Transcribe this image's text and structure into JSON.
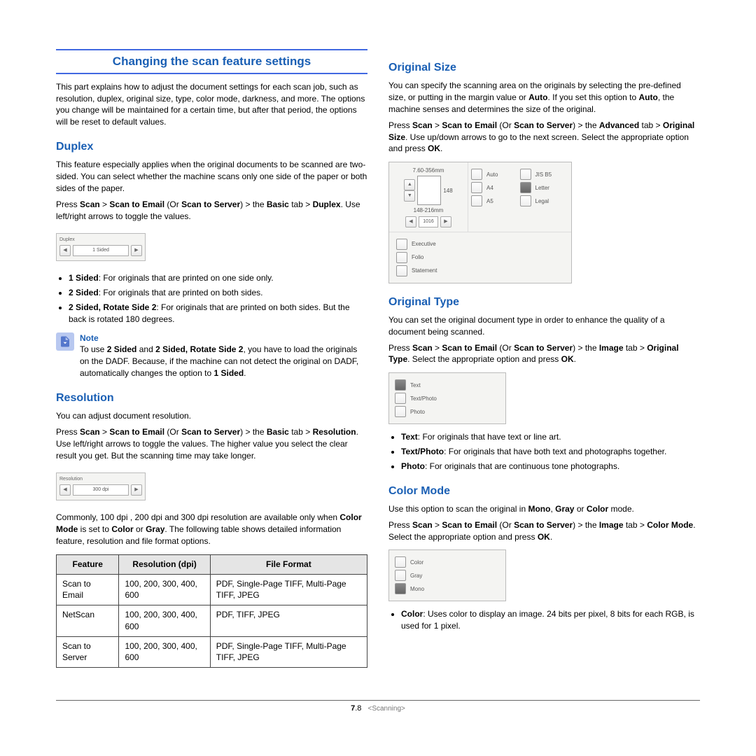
{
  "title": "Changing the scan feature settings",
  "intro": "This part explains how to adjust the document settings for each scan job, such as resolution, duplex, original size, type, color mode, darkness, and more. The options you change will be maintained for a certain time, but after that period, the options will be reset to default values.",
  "duplex": {
    "heading": "Duplex",
    "p1": "This feature especially applies when the original documents to be scanned are two-sided. You can select whether the machine scans only one side of the paper or both sides of the paper.",
    "p2_pre": "Press ",
    "scan": "Scan",
    "scan_to_email": "Scan to Email",
    "or": " (Or ",
    "scan_to_server": "Scan to Server",
    "the": ") > the ",
    "basic": "Basic",
    "tab_gt": " tab > ",
    "duplex_label": "Duplex",
    "p2_post": ". Use left/right arrows to toggle the values.",
    "b1_t": "1 Sided",
    "b1": ": For originals that are printed on one side only.",
    "b2_t": "2 Sided",
    "b2": ": For originals that are printed on both sides.",
    "b3_t": "2 Sided, Rotate Side 2",
    "b3": ": For originals that are printed on both sides. But the back is rotated 180 degrees.",
    "note_title": "Note",
    "note_body_1": "To use ",
    "note_body_2": " and ",
    "note_body_3": ", you have to load the originals on the DADF. Because, if the machine can not detect the original on DADF, automatically changes the option to ",
    "one_sided": "1 Sided"
  },
  "resolution": {
    "heading": "Resolution",
    "p1": "You can adjust document resolution.",
    "p2_post": ". Use left/right arrows to toggle the values. The higher value you select the clear result you get. But the scanning time may take longer.",
    "res_label": "Resolution",
    "p3_pre": "Commonly, 100 dpi , 200 dpi and 300 dpi resolution are available only when ",
    "color_mode": "Color Mode",
    "p3_mid": " is set to ",
    "color": "Color",
    "p3_or": " or ",
    "gray": "Gray",
    "p3_post": ". The following table shows detailed information feature, resolution and file format options.",
    "ui_value": "300 dpi",
    "table": {
      "headers": [
        "Feature",
        "Resolution (dpi)",
        "File Format"
      ],
      "rows": [
        [
          "Scan to Email",
          "100, 200, 300, 400, 600",
          "PDF, Single-Page TIFF, Multi-Page TIFF, JPEG"
        ],
        [
          "NetScan",
          "100, 200, 300, 400, 600",
          "PDF, TIFF, JPEG"
        ],
        [
          "Scan to Server",
          "100, 200, 300, 400, 600",
          "PDF, Single-Page TIFF, Multi-Page TIFF, JPEG"
        ]
      ]
    }
  },
  "original_size": {
    "heading": "Original Size",
    "p1_pre": "You can specify the scanning area on the originals by selecting the pre-defined size, or putting in the margin value or ",
    "auto": "Auto",
    "p1_mid": ". If you set this option to ",
    "p1_post": ", the machine senses and determines the size of the original.",
    "advanced": "Advanced",
    "tab_gt": " tab > ",
    "os_label": "Original Size",
    "p2_post": ". Use up/down arrows to go to the next screen. Select the appropriate option and press ",
    "ok": "OK",
    "ui": {
      "dims_top": "7.60-356mm",
      "dims_side": "148-216mm",
      "h": "148",
      "w": "1016",
      "opts_left": [
        "Auto",
        "A4",
        "A5"
      ],
      "opts_right": [
        "JIS B5",
        "Letter",
        "Legal"
      ],
      "opts_bottom": [
        "Executive",
        "Folio",
        "Statement"
      ]
    }
  },
  "original_type": {
    "heading": "Original Type",
    "p1": "You can set the original document type in order to enhance the quality of a document being scanned.",
    "image": "Image",
    "ot_label": "Original Type",
    "p2_post": ". Select the appropriate option and press ",
    "ok": "OK",
    "opts": [
      "Text",
      "Text/Photo",
      "Photo"
    ],
    "b1_t": "Text",
    "b1": ": For originals that have text or line art.",
    "b2_t": "Text/Photo",
    "b2": ": For originals that have both text and photographs together.",
    "b3_t": "Photo",
    "b3": ": For originals that are continuous tone photographs."
  },
  "color_mode": {
    "heading": "Color Mode",
    "p1_pre": "Use this option to scan the original in ",
    "mono": "Mono",
    "gray": "Gray",
    "color": "Color",
    "p1_post": " mode.",
    "cm_label": "Color Mode",
    "p2_post": ". Select the appropriate option and press ",
    "ok": "OK",
    "opts": [
      "Color",
      "Gray",
      "Mono"
    ],
    "b1_t": "Color",
    "b1": ": Uses color to display an image. 24 bits per pixel, 8 bits for each RGB, is used for 1 pixel."
  },
  "footer": {
    "page_prefix": "7",
    "page": ".8",
    "chapter": "<Scanning>"
  }
}
